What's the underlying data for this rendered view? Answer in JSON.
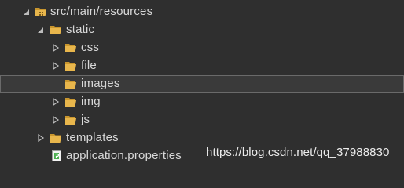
{
  "tree": {
    "root": {
      "label": "src/main/resources",
      "state": "expanded",
      "icon": "package-folder-icon"
    },
    "static": {
      "label": "static",
      "state": "expanded",
      "icon": "folder-open-icon"
    },
    "css": {
      "label": "css",
      "state": "collapsed",
      "icon": "folder-open-icon"
    },
    "file": {
      "label": "file",
      "state": "collapsed",
      "icon": "folder-open-icon"
    },
    "images": {
      "label": "images",
      "state": "leaf",
      "icon": "folder-open-icon",
      "selected": true
    },
    "img": {
      "label": "img",
      "state": "collapsed",
      "icon": "folder-open-icon"
    },
    "js": {
      "label": "js",
      "state": "collapsed",
      "icon": "folder-open-icon"
    },
    "templates": {
      "label": "templates",
      "state": "collapsed",
      "icon": "folder-open-icon"
    },
    "application_properties": {
      "label": "application.properties",
      "state": "leaf",
      "icon": "properties-file-icon"
    }
  },
  "watermark": "https://blog.csdn.net/qq_37988830",
  "colors": {
    "background": "#2f2f2f",
    "selection_background": "#3a3a3a",
    "selection_border": "#6a6a6a",
    "text": "#d8d8d8",
    "folder": "#e8b64c",
    "properties_file": "#4caf50"
  }
}
